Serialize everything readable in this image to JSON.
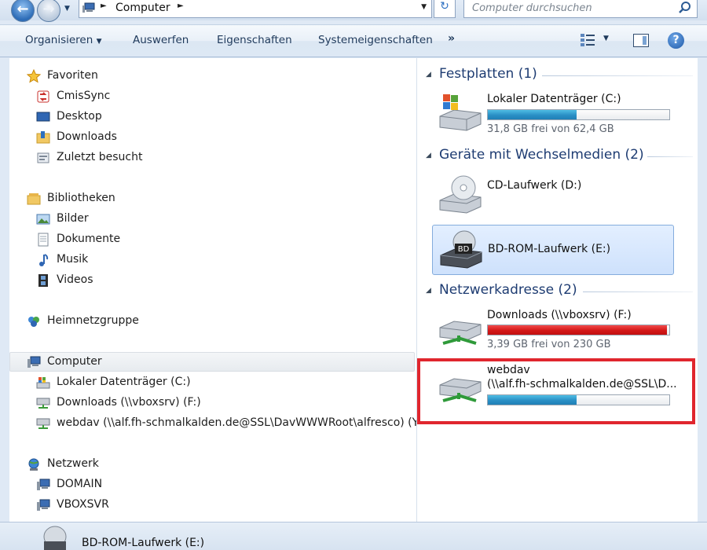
{
  "address": {
    "path": "Computer",
    "search_placeholder": "Computer durchsuchen"
  },
  "toolbar": {
    "organize": "Organisieren",
    "eject": "Auswerfen",
    "properties": "Eigenschaften",
    "system_properties": "Systemeigenschaften",
    "more": "»"
  },
  "nav": {
    "favorites": {
      "label": "Favoriten",
      "items": [
        "CmisSync",
        "Desktop",
        "Downloads",
        "Zuletzt besucht"
      ]
    },
    "libraries": {
      "label": "Bibliotheken",
      "items": [
        "Bilder",
        "Dokumente",
        "Musik",
        "Videos"
      ]
    },
    "homegroup": "Heimnetzgruppe",
    "computer": {
      "label": "Computer",
      "items": [
        "Lokaler Datenträger (C:)",
        "Downloads (\\\\vboxsrv) (F:)",
        "webdav (\\\\alf.fh-schmalkalden.de@SSL\\DavWWWRoot\\alfresco) (Y:)"
      ]
    },
    "network": {
      "label": "Netzwerk",
      "items": [
        "DOMAIN",
        "VBOXSVR"
      ]
    }
  },
  "content": {
    "groups": [
      {
        "title": "Festplatten (1)",
        "tiles": [
          {
            "name": "Lokaler Datenträger (C:)",
            "info": "31,8 GB frei von 62,4 GB",
            "used_fraction": 0.49,
            "bar_color": "blue"
          }
        ]
      },
      {
        "title": "Geräte mit Wechselmedien (2)",
        "tiles": [
          {
            "name": "CD-Laufwerk (D:)"
          },
          {
            "name": "BD-ROM-Laufwerk (E:)",
            "selected": true
          }
        ]
      },
      {
        "title": "Netzwerkadresse (2)",
        "tiles": [
          {
            "name": "Downloads (\\\\vboxsrv) (F:)",
            "info": "3,39 GB frei von 230 GB",
            "used_fraction": 0.985,
            "bar_color": "red"
          },
          {
            "name_line1": "webdav",
            "name_line2": "(\\\\alf.fh-schmalkalden.de@SSL\\D...",
            "used_fraction": 0.49,
            "bar_color": "blue",
            "highlighted": true
          }
        ]
      }
    ],
    "bd_label": "BD"
  },
  "status": {
    "selected_item": "BD-ROM-Laufwerk (E:)"
  },
  "colors": {
    "accent": "#1e3c72",
    "highlight": "#e0262e",
    "bar_blue": "#2a8fc5",
    "bar_red": "#d31818"
  }
}
